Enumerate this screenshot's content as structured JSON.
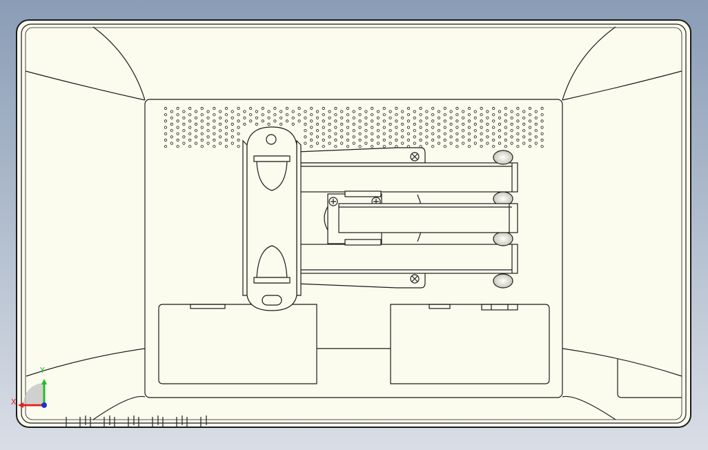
{
  "viewport": {
    "background_top": "#8a9db6",
    "background_bottom": "#d9dee6",
    "body_fill": "#fbfcee",
    "line_color": "#1a1a1a",
    "shade_color": "#dcdcd0"
  },
  "triad": {
    "x_label": "X",
    "y_label": "Y",
    "x_color": "#e02020",
    "y_color": "#20c020",
    "z_color": "#2030d0"
  }
}
